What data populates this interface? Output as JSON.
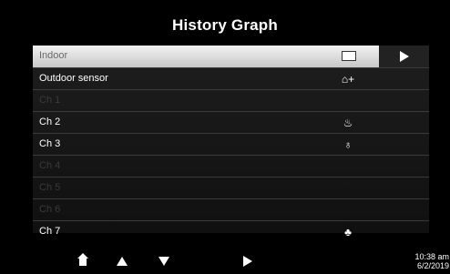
{
  "screen": {
    "title": "History Graph"
  },
  "channels": [
    {
      "label": "Indoor",
      "icon": "",
      "state": "selected"
    },
    {
      "label": "Outdoor sensor",
      "icon": "⌂+",
      "state": "enabled"
    },
    {
      "label": "Ch 1",
      "icon": "",
      "state": "disabled"
    },
    {
      "label": "Ch 2",
      "icon": "♨",
      "state": "enabled"
    },
    {
      "label": "Ch 3",
      "icon": "♁",
      "state": "enabled"
    },
    {
      "label": "Ch 4",
      "icon": "",
      "state": "disabled"
    },
    {
      "label": "Ch 5",
      "icon": "",
      "state": "disabled"
    },
    {
      "label": "Ch 6",
      "icon": "",
      "state": "disabled"
    },
    {
      "label": "Ch 7",
      "icon": "♣",
      "state": "enabled"
    }
  ],
  "bottom_bar": {
    "time": "10:38 am",
    "date": "6/2/2019"
  }
}
